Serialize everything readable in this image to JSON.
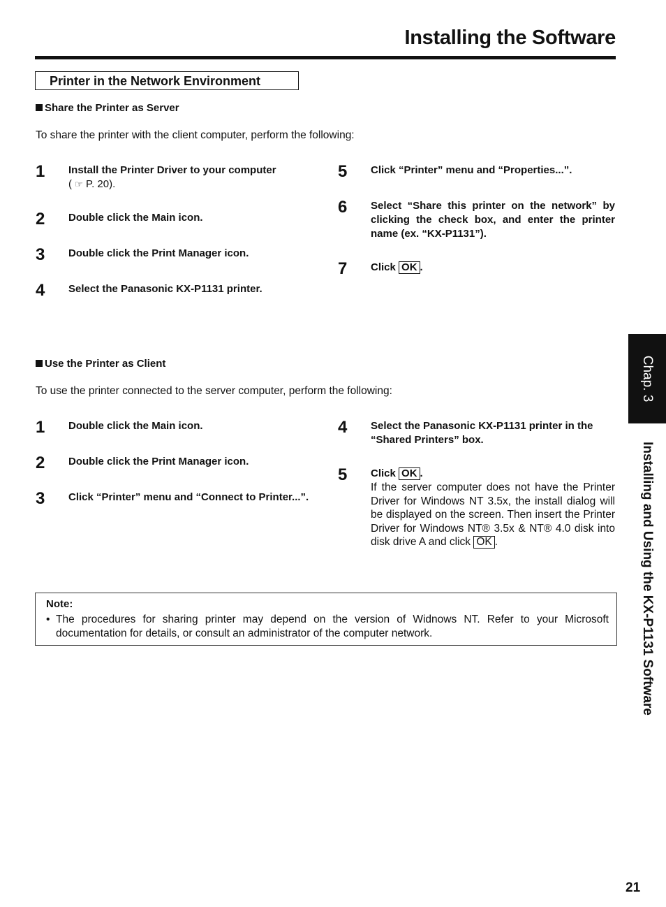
{
  "header": {
    "title": "Installing the Software"
  },
  "section": {
    "title": "Printer in the Network Environment"
  },
  "server": {
    "heading": "Share the Printer as Server",
    "intro": "To share the printer with the client computer, perform the following:",
    "steps": [
      {
        "num": "1",
        "text": "Install the Printer Driver to your computer",
        "ref_prefix": "( ",
        "ref_icon": "☞",
        "ref_text": " P. 20)."
      },
      {
        "num": "2",
        "text": "Double click the Main icon."
      },
      {
        "num": "3",
        "text": "Double click the Print Manager icon."
      },
      {
        "num": "4",
        "text": "Select the Panasonic KX-P1131 printer."
      },
      {
        "num": "5",
        "text": "Click “Printer” menu and “Properties...”."
      },
      {
        "num": "6",
        "text": "Select “Share this printer on the network” by clicking the check box, and enter the printer name (ex. “KX-P1131”)."
      },
      {
        "num": "7",
        "text": "Click",
        "button": "OK",
        "suffix": "."
      }
    ]
  },
  "client": {
    "heading": "Use the Printer as Client",
    "intro": "To use the printer connected to the server computer, perform the following:",
    "steps": [
      {
        "num": "1",
        "text": "Double click the Main icon."
      },
      {
        "num": "2",
        "text": "Double click the Print Manager icon."
      },
      {
        "num": "3",
        "text": "Click “Printer” menu and “Connect to Printer...”."
      },
      {
        "num": "4",
        "text": "Select the Panasonic KX-P1131 printer in the “Shared Printers” box."
      },
      {
        "num": "5",
        "text": "Click",
        "button": "OK",
        "suffix": ".",
        "detail": "If the server computer does not have the Printer Driver for Windows NT 3.5x, the install dialog will be displayed on the screen. Then insert the Printer Driver for Windows NT® 3.5x & NT® 4.0 disk into disk drive A and click",
        "detail_button": "OK",
        "detail_suffix": "."
      }
    ]
  },
  "note": {
    "label": "Note:",
    "bullet": "•",
    "text": "The procedures for sharing printer may depend on the version of Widnows NT. Refer to your Microsoft documentation for details, or consult an administrator of the computer network."
  },
  "sidebar": {
    "chapter_tab": "Chap. 3",
    "chapter_title": "Installing and Using the KX-P1131 Software"
  },
  "page_number": "21"
}
